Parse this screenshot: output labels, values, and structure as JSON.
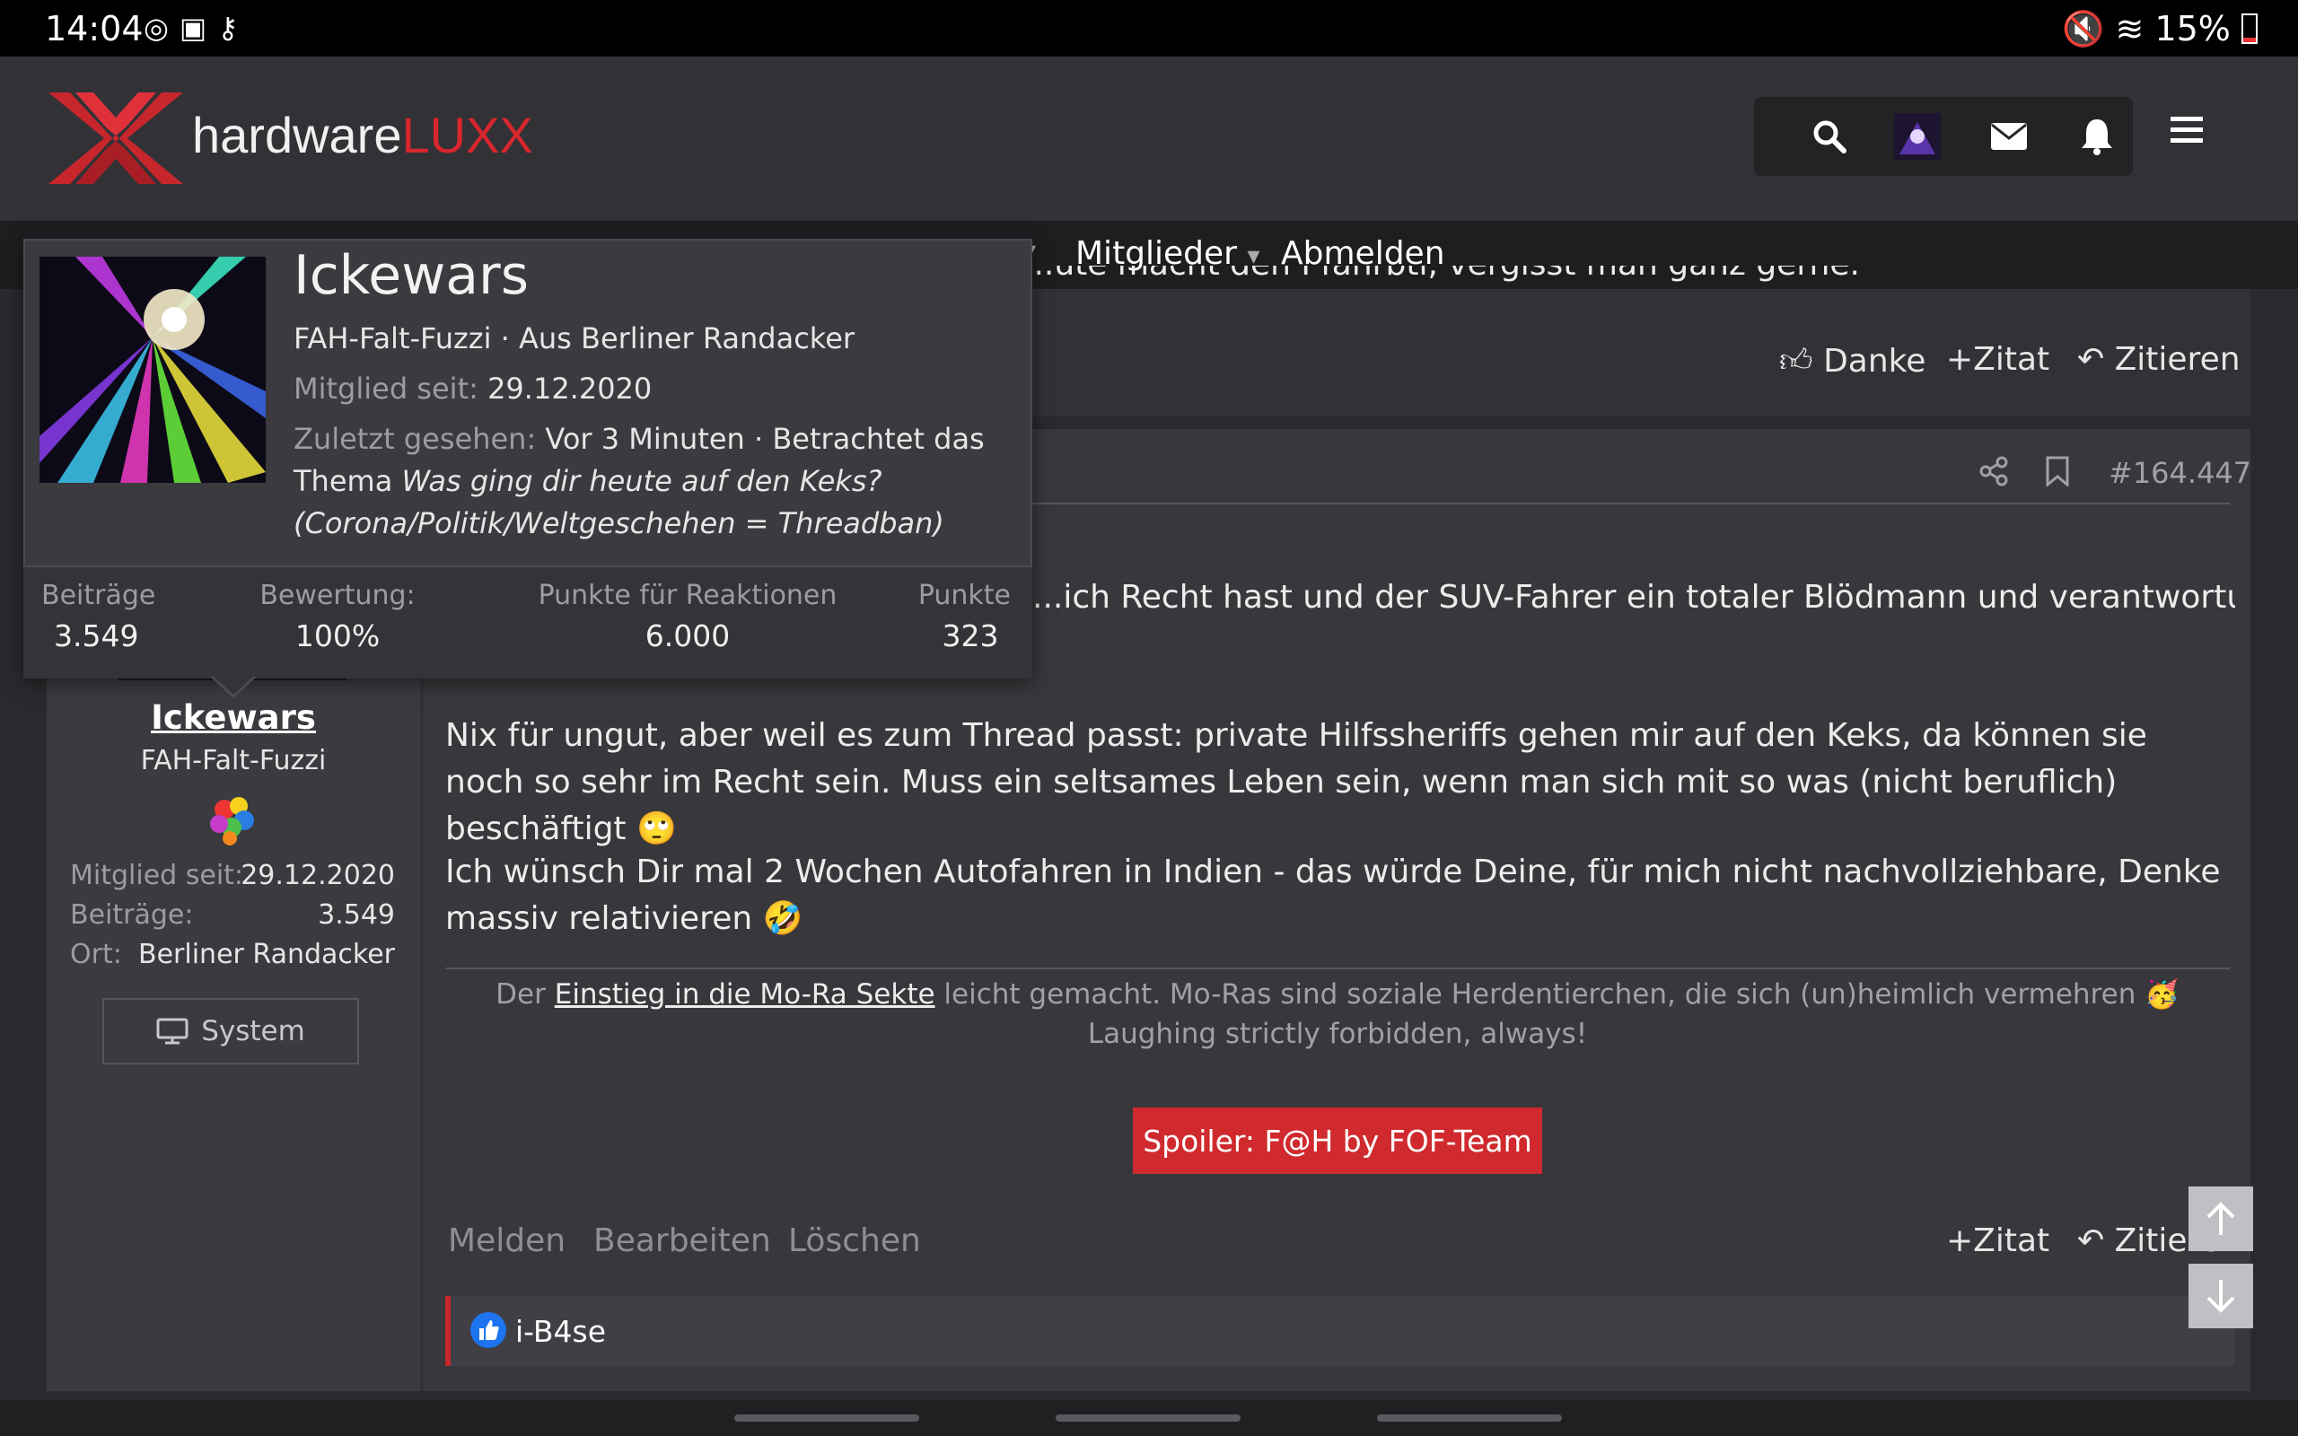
{
  "status": {
    "time": "14:04",
    "battery": "15%"
  },
  "brand": {
    "name_plain": "hardware",
    "name_accent": "LUXX",
    "accent_color": "#d8262d"
  },
  "nav": {
    "members": "Mitglieder",
    "logout": "Abmelden"
  },
  "prev_post": {
    "truncated_text": "...ute macht den Pfahrbti, vergisst man ganz gerne.",
    "thanks": "Danke",
    "quote_plus": "Zitat",
    "quote": "Zitieren"
  },
  "post": {
    "number": "#164.447",
    "p1": "...ich Recht hast und der SUV-Fahrer ein totaler Blödmann und verantwortungsloser",
    "p2": "Nix für ungut, aber weil es zum Thread passt: private Hilfssheriffs gehen mir auf den Keks, da können sie noch so sehr im Recht sein. Muss ein seltsames Leben sein, wenn man sich mit so was (nicht beruflich) beschäftigt 🙄",
    "p3": "Ich wünsch Dir mal 2 Wochen Autofahren in Indien - das würde Deine, für mich nicht nachvollziehbare, Denke massiv relativieren 🤣",
    "sig_prefix": "Der",
    "sig_link": "Einstieg in die Mo-Ra Sekte",
    "sig_suffix": "leicht gemacht. Mo-Ras sind soziale Herdentierchen, die sich (un)heimlich vermehren 🥳",
    "sig_line2": "Laughing strictly forbidden, always!",
    "spoiler": "Spoiler: F@H by FOF-Team",
    "report": "Melden",
    "edit": "Bearbeiten",
    "delete": "Löschen",
    "quote_plus": "Zitat",
    "quote": "Zitieren",
    "reaction_user": "i-B4se"
  },
  "sidebar": {
    "username": "Ickewars",
    "user_title": "FAH-Falt-Fuzzi",
    "member_since_label": "Mitglied seit:",
    "member_since": "29.12.2020",
    "posts_label": "Beiträge:",
    "posts": "3.549",
    "location_label": "Ort:",
    "location": "Berliner Randacker",
    "system_button": "System"
  },
  "popup": {
    "username": "Ickewars",
    "subtitle": "FAH-Falt-Fuzzi · Aus Berliner Randacker",
    "member_since_label": "Mitglied seit:",
    "member_since": "29.12.2020",
    "last_seen_label": "Zuletzt gesehen:",
    "last_seen": "Vor 3 Minuten · Betrachtet das",
    "thread_prefix": "Thema",
    "thread_title_1": "Was ging dir heute auf den Keks?",
    "thread_title_2": "(Corona/Politik/Weltgeschehen = Threadban)",
    "stats": {
      "posts_label": "Beiträge",
      "posts": "3.549",
      "rating_label": "Bewertung:",
      "rating": "100%",
      "reaction_points_label": "Punkte für Reaktionen",
      "reaction_points": "6.000",
      "points_label": "Punkte",
      "points": "323"
    }
  }
}
